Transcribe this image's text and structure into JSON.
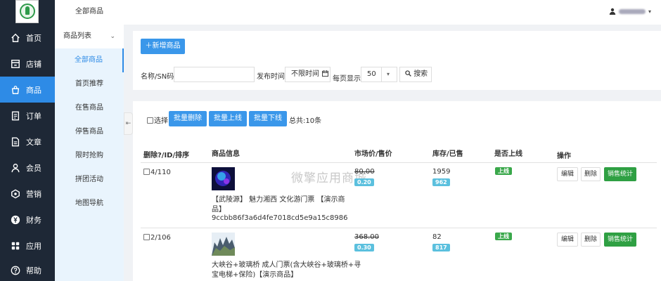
{
  "sidebar": {
    "items": [
      {
        "label": "首页",
        "icon": "home-icon"
      },
      {
        "label": "店铺",
        "icon": "store-icon"
      },
      {
        "label": "商品",
        "icon": "bag-icon"
      },
      {
        "label": "订单",
        "icon": "order-icon"
      },
      {
        "label": "文章",
        "icon": "article-icon"
      },
      {
        "label": "会员",
        "icon": "member-icon"
      },
      {
        "label": "营销",
        "icon": "marketing-icon"
      },
      {
        "label": "财务",
        "icon": "finance-icon"
      },
      {
        "label": "应用",
        "icon": "apps-icon"
      },
      {
        "label": "帮助",
        "icon": "help-icon"
      }
    ],
    "active_index": 2,
    "accent": "#2e8be6"
  },
  "submenu": {
    "top": "全部商品",
    "group": "商品列表",
    "children": [
      "全部商品",
      "首页推荐",
      "在售商品",
      "停售商品",
      "限时抢购",
      "拼团活动",
      "地图导航"
    ]
  },
  "toolbar": {
    "add_label": "＋新增商品"
  },
  "filter": {
    "name_label": "名称/SN码",
    "name_value": "",
    "time_label": "发布时间",
    "time_value": "不限时间",
    "page_label": "每页显示",
    "page_value": "50",
    "search_label": "搜索"
  },
  "bulk": {
    "select_label": "选择",
    "delete_label": "批量删除",
    "online_label": "批量上线",
    "offline_label": "批量下线",
    "total_text": "总共:10条"
  },
  "table": {
    "headers": [
      "删除?/ID/排序",
      "商品信息",
      "市场价/售价",
      "库存/已售",
      "是否上线",
      "操作"
    ],
    "rows": [
      {
        "id_sort": "4/110",
        "name_line1": "【武陵源】 魅力湘西 文化游门票 【演示商",
        "name_line2": "品】",
        "sn": "9ccbb86f3a6d4fe7018cd5e9a15c8986",
        "market_price": "80.00",
        "sale_price": "0.20",
        "stock": "1959",
        "sold": "962",
        "status": "上线",
        "edit": "编辑",
        "delete": "删除",
        "stats": "销售统计"
      },
      {
        "id_sort": "2/106",
        "name_line1": "大峡谷+玻璃桥 成人门票(含大峡谷+玻璃桥+寻",
        "name_line2": "宝电梯+保险)【演示商品】",
        "sn": "",
        "market_price": "368.00",
        "sale_price": "0.30",
        "stock": "82",
        "sold": "817",
        "status": "上线",
        "edit": "编辑",
        "delete": "删除",
        "stats": "销售统计"
      }
    ]
  },
  "watermark": "微擎应用商城"
}
